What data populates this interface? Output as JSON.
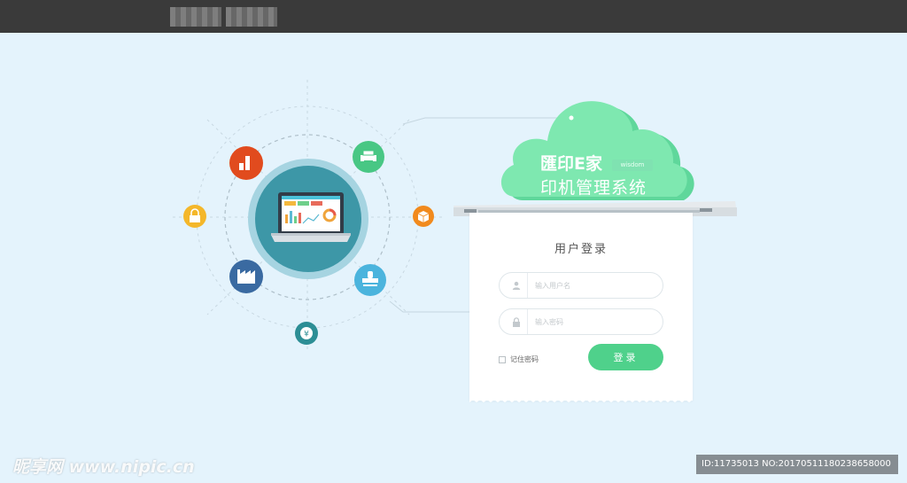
{
  "brand": {
    "name": "匯印E家",
    "tag": "wisdom",
    "subtitle": "印机管理系统"
  },
  "login": {
    "title": "用户登录",
    "username_placeholder": "输入用户名",
    "password_placeholder": "输入密码",
    "remember_label": "记住密码",
    "login_button": "登录"
  },
  "illustration": {
    "icons": [
      "chart-icon",
      "printer-icon",
      "lock-icon",
      "package-icon",
      "factory-icon",
      "stamp-icon",
      "yen-icon",
      "laptop-icon"
    ]
  },
  "watermark": {
    "site": "昵享网 www.nipic.cn",
    "id": "ID:11735013 NO:20170511180238658000"
  },
  "colors": {
    "background": "#e4f3fc",
    "topbar": "#3a3a3a",
    "accent_green": "#4fd18b",
    "cloud": "#7ee8b0"
  }
}
